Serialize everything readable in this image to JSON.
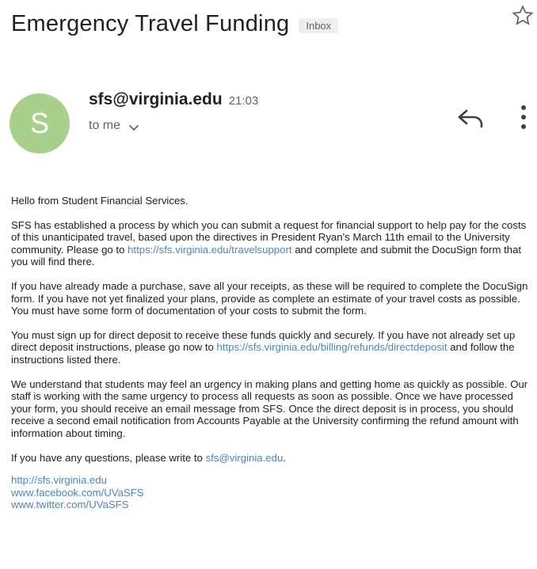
{
  "subject": "Emergency Travel Funding",
  "label": "Inbox",
  "sender": {
    "avatar_letter": "S",
    "email": "sfs@virginia.edu",
    "time": "21:03",
    "to": "to me"
  },
  "icons": {
    "star": "star-icon",
    "reply": "reply-icon",
    "more": "more-vert-icon",
    "chevron": "chevron-down-icon"
  },
  "colors": {
    "avatar": "#a8d08a",
    "link": "#4a86c5"
  },
  "body": {
    "greeting": "Hello from Student Financial Services.",
    "p1_text": "SFS has established a process by which you can submit a request for financial support to help pay for the costs of this unanticipated travel, based upon the directives in President Ryan's March 11th email to the University community.  Please go to ",
    "p1_link": "https://sfs.virginia.edu/travelsupport",
    "p1_text_after": " and complete and submit the DocuSign form that you will find there.",
    "p2_text": "If you have already made a purchase, save all your receipts, as these will be required to complete the DocuSign form. If you have not yet finalized your plans, provide as complete an estimate of your travel costs as possible.  You must have some form of documentation of your costs to submit the form.",
    "p3_text": "You must sign up for direct deposit to receive these funds quickly and securely.  If you have not already set up direct deposit instructions, please go now to ",
    "p3_link": "https://sfs.virginia.edu/billing/refunds/directdeposit",
    "p3_text_after": " and follow the instructions listed there.",
    "p4_text": "We understand that students may feel an urgency in making plans and getting home as quickly as possible.  Our staff is working with the same urgency to process all requests as soon as possible. Once we have processed your form, you should receive an email message from SFS.  Once the direct deposit is in process, you should receive a second email notification from Accounts Payable at the University confirming the refund amount with information about timing.",
    "p5_text": "If you have any questions, please write to ",
    "p5_link": "sfs@virginia.edu",
    "p5_text_after": ".",
    "footer_links": [
      "http://sfs.virginia.edu",
      "www.facebook.com/UVaSFS",
      "www.twitter.com/UVaSFS"
    ]
  }
}
